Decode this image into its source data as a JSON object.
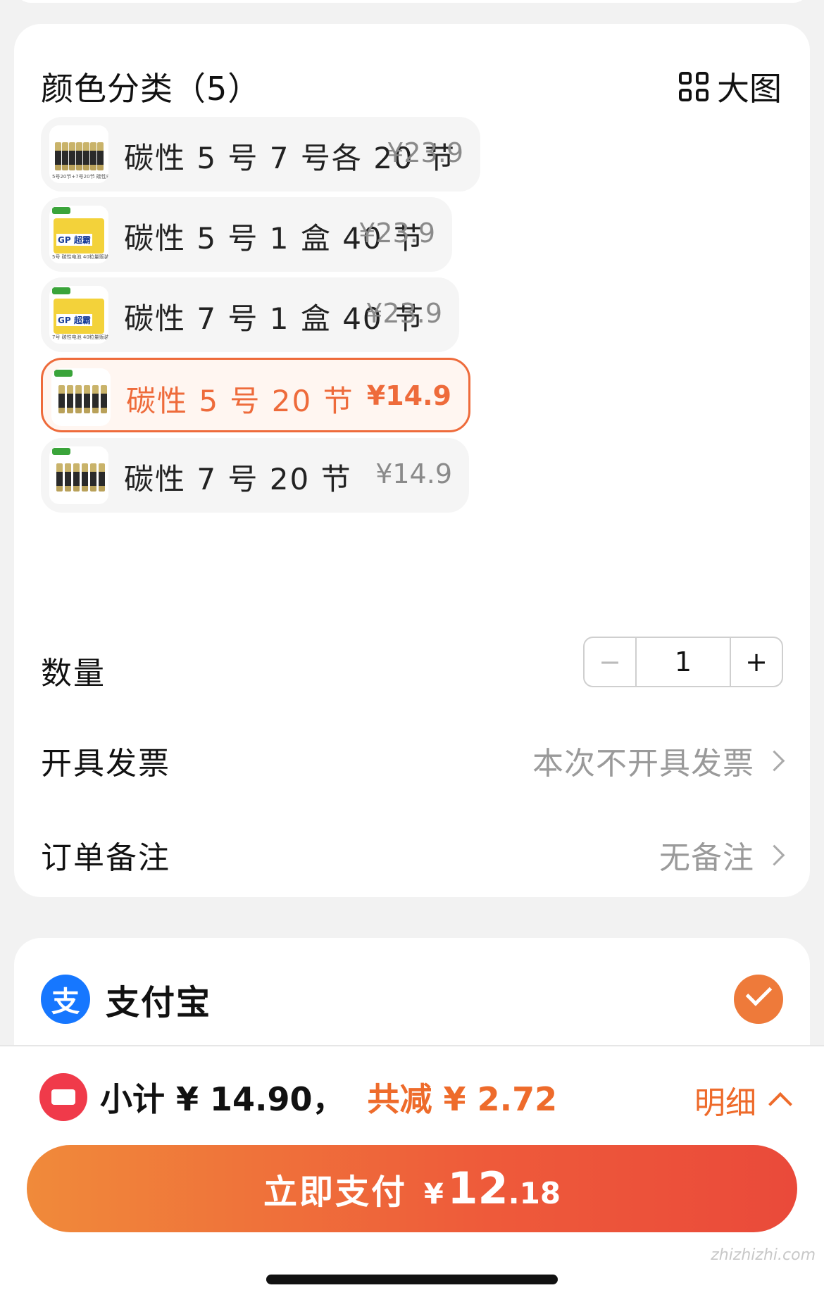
{
  "sku_section": {
    "title": "颜色分类（5）",
    "big_view_label": "大图",
    "options": [
      {
        "name": "碳性 5 号 7 号各 20 节",
        "price": "¥23.9",
        "selected": false,
        "thumb_caption": "5号20节+7号20节 碳性电池"
      },
      {
        "name": "碳性 5 号 1 盒 40 节",
        "price": "¥23.9",
        "selected": false,
        "thumb_caption": "5号 碳性电池 40粒量贩装"
      },
      {
        "name": "碳性 7 号 1 盒 40 节",
        "price": "¥23.9",
        "selected": false,
        "thumb_caption": "7号 碳性电池 40粒量贩装"
      },
      {
        "name": "碳性 5 号 20 节",
        "price": "¥14.9",
        "selected": true,
        "thumb_caption": ""
      },
      {
        "name": "碳性 7 号 20 节",
        "price": "¥14.9",
        "selected": false,
        "thumb_caption": ""
      }
    ]
  },
  "quantity": {
    "label": "数量",
    "minus": "−",
    "value": "1",
    "plus": "+"
  },
  "invoice": {
    "label": "开具发票",
    "value": "本次不开具发票"
  },
  "remark": {
    "label": "订单备注",
    "value": "无备注"
  },
  "payment": {
    "method_icon": "支",
    "method_name": "支付宝",
    "selected": true
  },
  "summary": {
    "subtotal": "小计 ¥ 14.90，",
    "saving": "共减 ¥ 2.72",
    "detail_label": "明细"
  },
  "pay_button": {
    "label": "立即支付",
    "currency": "¥",
    "amount_int": "12",
    "amount_dec": ".18"
  },
  "watermark": "zhizhizhi.com",
  "colors": {
    "accent": "#ee6b3b",
    "alipay": "#1677ff",
    "coupon": "#f03a4a"
  }
}
